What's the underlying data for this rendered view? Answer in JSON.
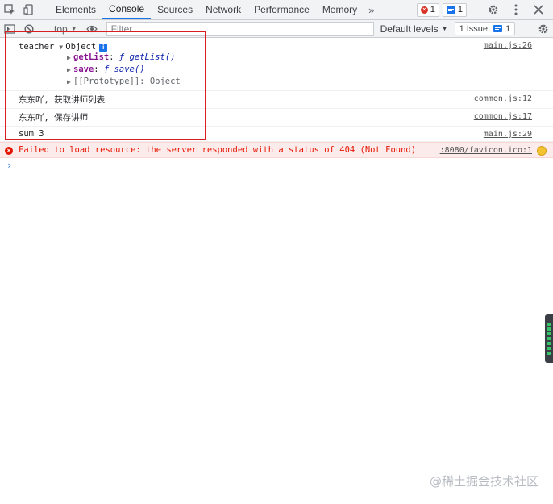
{
  "tabbar": {
    "tabs": [
      "Elements",
      "Console",
      "Sources",
      "Network",
      "Performance",
      "Memory"
    ],
    "more": "»",
    "error_count": "1",
    "message_count": "1"
  },
  "console_toolbar": {
    "context": "top",
    "filter_placeholder": "Filter",
    "levels": "Default levels",
    "issues": "1 Issue:",
    "issues_count": "1"
  },
  "logs": {
    "teacher": {
      "label": "teacher",
      "type": "Object",
      "props": [
        {
          "key": "getList",
          "value": "ƒ getList()"
        },
        {
          "key": "save",
          "value": "ƒ save()"
        }
      ],
      "proto": "[[Prototype]]: Object",
      "source": "main.js:26"
    },
    "msg1": {
      "text": "东东吖, 获取讲师列表",
      "source": "common.js:12"
    },
    "msg2": {
      "text": "东东吖, 保存讲师",
      "source": "common.js:17"
    },
    "sum": {
      "text": "sum 3",
      "source": "main.js:29"
    },
    "error": {
      "text": "Failed to load resource: the server responded with a status of 404 (Not Found)",
      "source": ":8080/favicon.ico:1"
    }
  },
  "watermark": "@稀土掘金技术社区",
  "colors": {
    "highlight": "#d81e1e",
    "accent": "#1a73e8",
    "error": "#e51400"
  }
}
